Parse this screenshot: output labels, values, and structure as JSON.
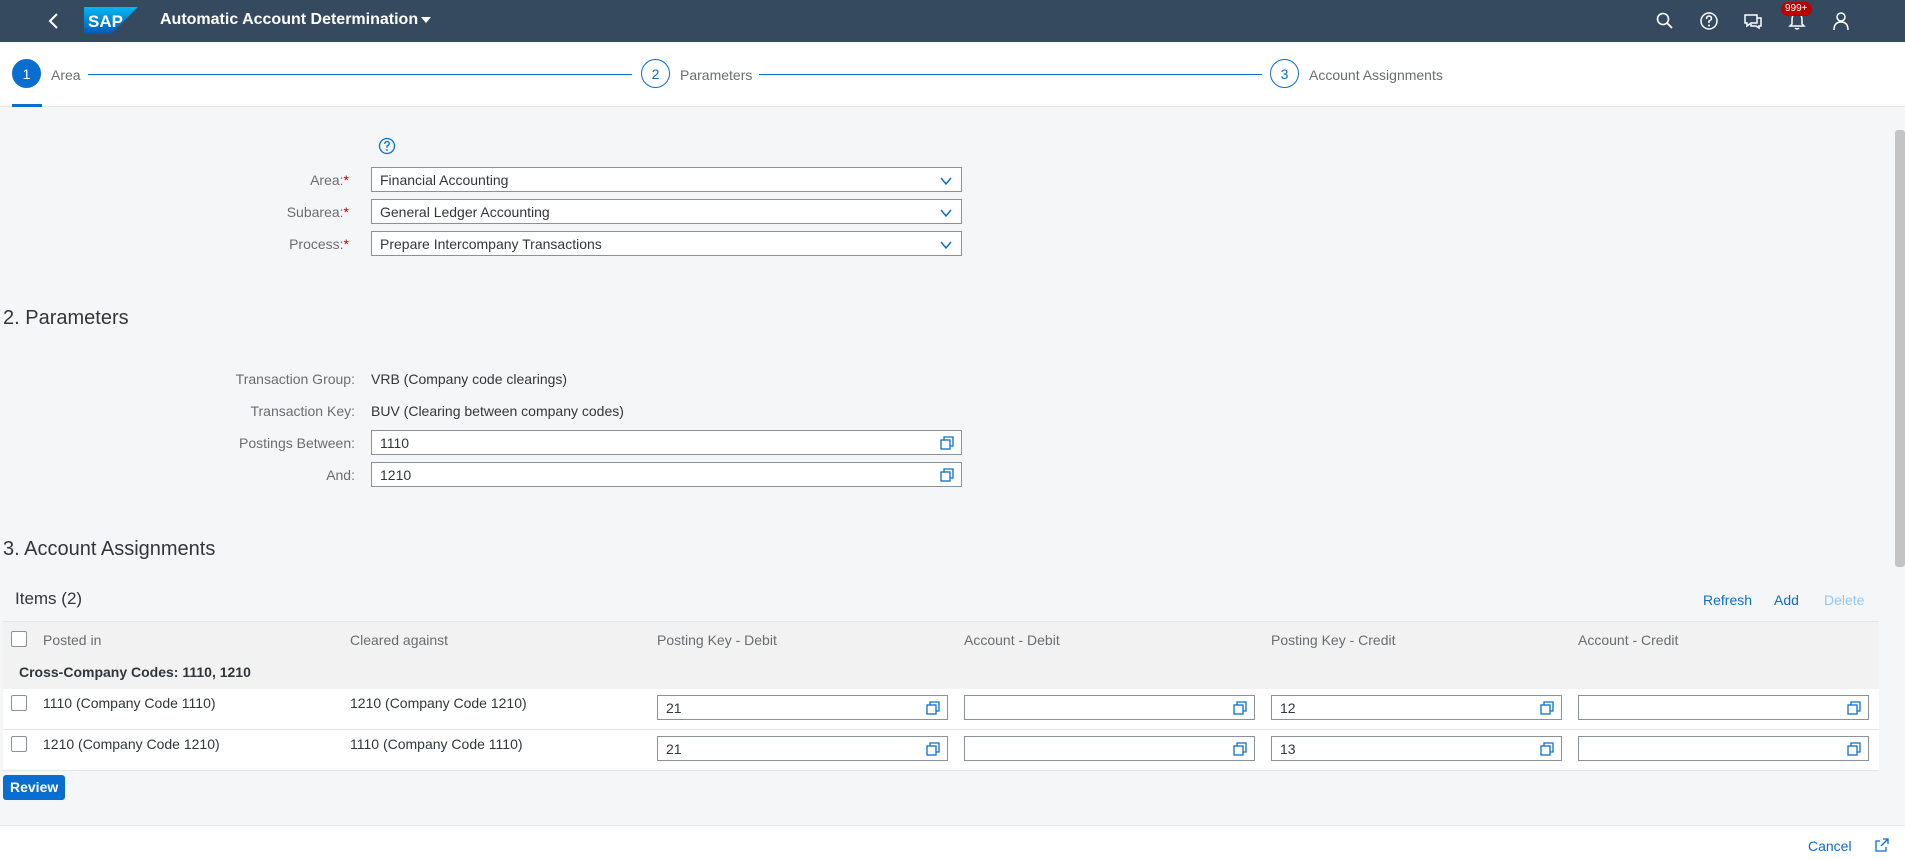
{
  "shell": {
    "title": "Automatic Account Determination",
    "logo_text": "SAP",
    "notification_count": "999+",
    "icons": [
      "back-icon",
      "search-icon",
      "help-icon",
      "feedback-icon",
      "bell-icon",
      "user-icon"
    ]
  },
  "wizard": {
    "steps": [
      {
        "number": "1",
        "label": "Area",
        "active": true
      },
      {
        "number": "2",
        "label": "Parameters",
        "active": false
      },
      {
        "number": "3",
        "label": "Account Assignments",
        "active": false
      }
    ]
  },
  "area_form": {
    "area_label": "Area:",
    "area_value": "Financial Accounting",
    "subarea_label": "Subarea:",
    "subarea_value": "General Ledger Accounting",
    "process_label": "Process:",
    "process_value": "Prepare Intercompany Transactions",
    "required_mark": "*"
  },
  "parameters": {
    "section_title": "2. Parameters",
    "transaction_group_label": "Transaction Group:",
    "transaction_group_value": "VRB (Company code clearings)",
    "transaction_key_label": "Transaction Key:",
    "transaction_key_value": "BUV (Clearing between company codes)",
    "postings_between_label": "Postings Between:",
    "postings_between_value": "1110",
    "and_label": "And:",
    "and_value": "1210"
  },
  "assignments": {
    "section_title": "3. Account Assignments",
    "items_title": "Items (2)",
    "refresh_label": "Refresh",
    "add_label": "Add",
    "delete_label": "Delete",
    "columns": [
      "Posted in",
      "Cleared against",
      "Posting Key - Debit",
      "Account - Debit",
      "Posting Key - Credit",
      "Account - Credit"
    ],
    "group_label": "Cross-Company Codes: 1110, 1210",
    "rows": [
      {
        "posted_in": "1110 (Company Code 1110)",
        "cleared_against": "1210 (Company Code 1210)",
        "pk_debit": "21",
        "account_debit": "",
        "pk_credit": "12",
        "account_credit": ""
      },
      {
        "posted_in": "1210 (Company Code 1210)",
        "cleared_against": "1110 (Company Code 1110)",
        "pk_debit": "21",
        "account_debit": "",
        "pk_credit": "13",
        "account_credit": ""
      }
    ]
  },
  "actions": {
    "review_label": "Review",
    "cancel_label": "Cancel"
  },
  "colors": {
    "shell_bg": "#354a5f",
    "accent": "#0a6ed1",
    "required": "#bb0000"
  }
}
